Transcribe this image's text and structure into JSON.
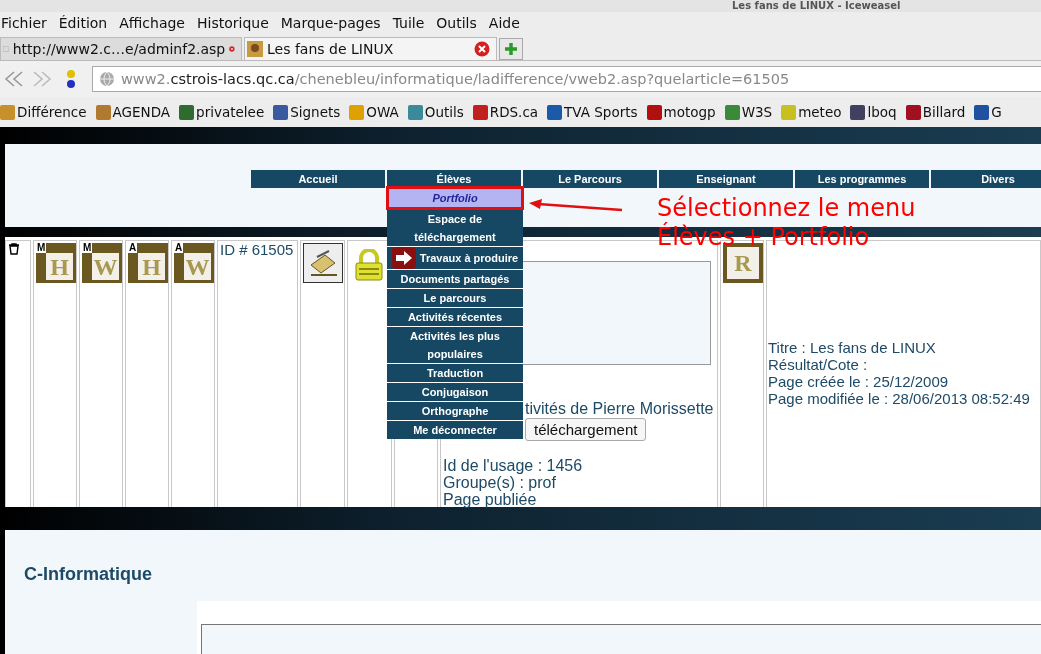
{
  "window": {
    "title": "Les fans de LINUX - Iceweasel"
  },
  "menu_bar": [
    "Fichier",
    "Édition",
    "Affichage",
    "Historique",
    "Marque-pages",
    "Tuile",
    "Outils",
    "Aide"
  ],
  "tabs": [
    {
      "title": "http://www2.c…e/adminf2.asp",
      "selected": false
    },
    {
      "title": "Les fans de LINUX",
      "selected": true
    }
  ],
  "address_bar": {
    "url_prefix": "www2.",
    "url_domain": "cstrois-lacs.qc.ca",
    "url_path": "/chenebleu/informatique/ladifference/vweb2.asp?quelarticle=61505"
  },
  "bookmarks": [
    "Différence",
    "AGENDA",
    "privatelee",
    "Signets",
    "OWA",
    "Outils",
    "RDS.ca",
    "TVA Sports",
    "motogp",
    "W3S",
    "meteo",
    "lboq",
    "Billard",
    "G"
  ],
  "site_nav": {
    "items": [
      {
        "label": "Accueil",
        "open": false
      },
      {
        "label": "Élèves",
        "open": true
      },
      {
        "label": "Le Parcours",
        "open": false
      },
      {
        "label": "Enseignant",
        "open": false
      },
      {
        "label": "Les programmes",
        "open": false
      },
      {
        "label": "Divers",
        "open": false
      }
    ],
    "dropdown": [
      {
        "label": "Portfolio",
        "selected": true,
        "kind": "plain"
      },
      {
        "label": "Espace de téléchargement",
        "selected": false,
        "kind": "plain"
      },
      {
        "label": "Travaux à produire",
        "selected": false,
        "kind": "arrow"
      },
      {
        "label": "Documents partagés",
        "selected": false,
        "kind": "plain"
      },
      {
        "label": "Le parcours",
        "selected": false,
        "kind": "plain"
      },
      {
        "label": "Activités récentes",
        "selected": false,
        "kind": "plain"
      },
      {
        "label": "Activités les plus populaires",
        "selected": false,
        "kind": "plain"
      },
      {
        "label": "Traduction",
        "selected": false,
        "kind": "plain"
      },
      {
        "label": "Conjugaison",
        "selected": false,
        "kind": "plain"
      },
      {
        "label": "Orthographe",
        "selected": false,
        "kind": "plain"
      },
      {
        "label": "Me déconnecter",
        "selected": false,
        "kind": "plain"
      }
    ]
  },
  "article_row": {
    "monograms": [
      {
        "badge": "M",
        "letter": "H"
      },
      {
        "badge": "M",
        "letter": "W"
      },
      {
        "badge": "A",
        "letter": "H"
      },
      {
        "badge": "A",
        "letter": "W"
      }
    ],
    "id_label": "ID # 61505",
    "author_line": "tivités de Pierre Morissette",
    "button": "téléchargement",
    "details": [
      "Id de l'usage : 1456",
      "Groupe(s) : prof",
      "Page publiée"
    ],
    "review_letter": "R",
    "info": [
      "Titre : Les fans de LINUX",
      "Résultat/Cote :",
      "Page créée le : 25/12/2009",
      "Page modifiée le : 28/06/2013 08:52:49"
    ]
  },
  "annotation": {
    "lines": [
      "Sélectionnez le menu",
      "Élèves + Portfolio"
    ]
  },
  "footer": {
    "heading": "C-Informatique"
  }
}
